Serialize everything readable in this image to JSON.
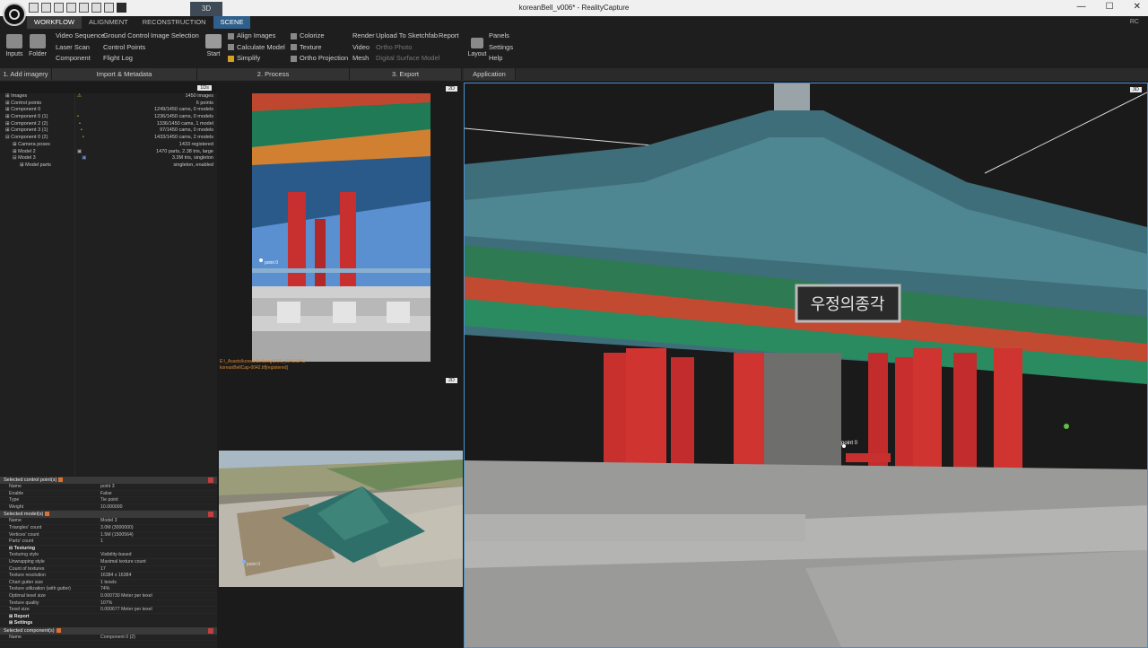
{
  "window": {
    "title": "koreanBell_v006* - RealityCapture",
    "view_tab": "3D",
    "controls": [
      "—",
      "☐",
      "✕"
    ]
  },
  "ribbon": {
    "tabs": [
      "WORKFLOW",
      "ALIGNMENT",
      "RECONSTRUCTION",
      "SCENE"
    ],
    "user_badge": "RC",
    "buttons": {
      "inputs": "Inputs",
      "folder": "Folder",
      "start": "Start",
      "layout": "Layout"
    },
    "import_col1": [
      "Video Sequence",
      "Laser Scan",
      "Component"
    ],
    "import_col2": [
      "Ground Control",
      "Control Points",
      "Flight Log"
    ],
    "import_col3": [
      "Image Selection"
    ],
    "process_col1": [
      "Align Images",
      "Calculate Model",
      "Simplify"
    ],
    "process_col2": [
      "Colorize",
      "Texture",
      "Ortho Projection"
    ],
    "export_col1": [
      "Render",
      "Video",
      "Mesh"
    ],
    "export_col2": [
      "Upload To Sketchfab",
      "Ortho Photo",
      "Digital Surface Model"
    ],
    "export_col3": [
      "Report"
    ],
    "app_col": [
      "Panels",
      "Settings",
      "Help"
    ],
    "sections": [
      "1. Add imagery",
      "Import & Metadata",
      "2. Process",
      "3. Export",
      "Application"
    ]
  },
  "tree": {
    "header_badge": "1Ds",
    "items": [
      "Images",
      "Control points",
      "Component 0",
      "Component 0 (1)",
      "Component 2 (2)",
      "Component 3 (1)",
      "Component 0 (2)",
      "Camera poses",
      "Model 2",
      "Model 3",
      "Model parts"
    ],
    "values": [
      "1450 images",
      "6 points",
      "1249/1450 cams, 0 models",
      "1236/1450 cams, 0 models",
      "1336/1450 cams, 1 model",
      "97/1450 cams, 0 models",
      "1433/1450 cams, 2 models",
      "1433 registered",
      "1470 parts, 2.38 tris, large",
      "3.3M tris, singleton",
      "singleton, enabled"
    ]
  },
  "props": {
    "section1": "Selected control point(s)",
    "cp_rows": [
      [
        "Name",
        "point 3"
      ],
      [
        "Enable",
        "False"
      ],
      [
        "Type",
        "Tie point"
      ],
      [
        "Weight",
        "10.000000"
      ]
    ],
    "section2": "Selected model(s)",
    "model_rows": [
      [
        "Name",
        "Model 3"
      ],
      [
        "Triangles' count",
        "3.0M (3000000)"
      ],
      [
        "Vertices' count",
        "1.5M (1500564)"
      ],
      [
        "Parts' count",
        "1"
      ]
    ],
    "texturing_label": "Texturing",
    "tex_rows": [
      [
        "Texturing style",
        "Visibility-based"
      ],
      [
        "Unwrapping style",
        "Maximal texture count"
      ],
      [
        "Count of textures",
        "17"
      ],
      [
        "Texture resolution",
        "16384 x 16384"
      ],
      [
        "Chart gutter size",
        "1 texels"
      ],
      [
        "Texture utilization (with gutter)",
        "74%"
      ],
      [
        "Optimal texel size",
        "0.000730 Meter per texel"
      ],
      [
        "Texture quality",
        "107%"
      ],
      [
        "Texel size",
        "0.000677 Meter per texel"
      ]
    ],
    "report_label": "Report",
    "settings_label": "Settings",
    "section3": "Selected component(s)",
    "comp_row": [
      "Name",
      "Component 0 (2)"
    ]
  },
  "views": {
    "badge_2d_a": "2D",
    "badge_2d_b": "2D",
    "badge_3d": "3D",
    "caption_line1": "E:\\_Assets\\koreanBell\\img\\DSC_0042.JPG",
    "caption_line2": "koreanBellCap-0042.tif[registered]",
    "point_label_a": "point 0",
    "point_label_b": "point 0",
    "point_label_3d": "point 0",
    "sign_text": "우정의종각"
  }
}
